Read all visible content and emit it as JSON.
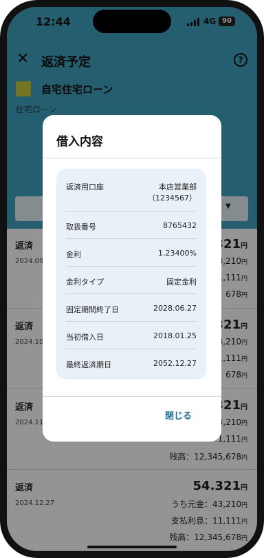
{
  "status_bar": {
    "time": "12:44",
    "network": "4G",
    "battery": "90"
  },
  "header": {
    "title": "返済予定",
    "close_glyph": "✕",
    "help_glyph": "?"
  },
  "loan": {
    "name": "自宅住宅ローン",
    "type": "住宅ローン"
  },
  "schedule": [
    {
      "label": "返済",
      "date": "2024.09",
      "amount": "321",
      "amount_unit": "円",
      "principal": "3,210",
      "interest": "1,111",
      "balance": "678",
      "unit": "円"
    },
    {
      "label": "返済",
      "date": "2024.10",
      "amount": "321",
      "amount_unit": "円",
      "principal": "3,210",
      "interest": "1,111",
      "balance": "678",
      "unit": "円"
    },
    {
      "label": "返済",
      "date": "2024.11",
      "amount": "321",
      "amount_unit": "円",
      "principal": "3,210",
      "interest": "1,111",
      "balance": "残高：12,345,678",
      "unit": "円"
    },
    {
      "label": "返済",
      "date": "2024.12.27",
      "amount": "54.321",
      "amount_unit": "円",
      "principal": "うち元金：43,210",
      "interest": "支払利息：11,111",
      "balance": "残高：12,345,678",
      "unit": "円"
    }
  ],
  "modal": {
    "title": "借入内容",
    "rows": [
      {
        "key": "返済用口座",
        "value": "本店営業部",
        "value2": "（1234567）"
      },
      {
        "key": "取扱番号",
        "value": "8765432"
      },
      {
        "key": "金利",
        "value": "1.23400%"
      },
      {
        "key": "金利タイプ",
        "value": "固定金利"
      },
      {
        "key": "固定期間終了日",
        "value": "2028.06.27"
      },
      {
        "key": "当初借入日",
        "value": "2018.01.25"
      },
      {
        "key": "最終返済期日",
        "value": "2052.12.27"
      }
    ],
    "close_label": "閉じる"
  },
  "colors": {
    "header": "#3fa3bf",
    "chip": "#c8c83c",
    "card": "#e9f1f8",
    "link": "#1a7090"
  }
}
